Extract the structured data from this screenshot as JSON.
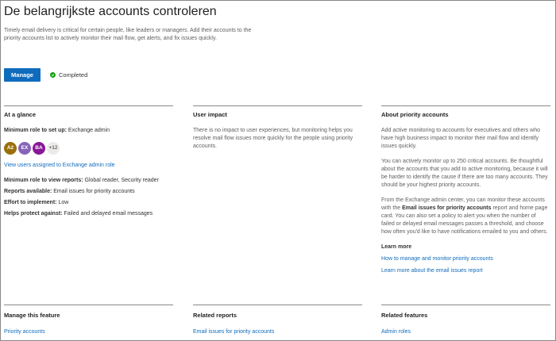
{
  "header": {
    "title": "De belangrijkste accounts controleren",
    "description": "Timely email delivery is critical for certain people, like leaders or managers. Add their accounts to the priority accounts list to actively monitor their mail flow, get alerts, and fix issues quickly.",
    "manage_label": "Manage",
    "status_label": "Completed",
    "status_color": "#13a10e",
    "accent_color": "#0f6cbd"
  },
  "glance": {
    "heading": "At a glance",
    "min_role_setup_label": "Minimum role to set up:",
    "min_role_setup_value": " Exchange admin",
    "avatars": [
      {
        "initials": "A2",
        "color": "#986f0b"
      },
      {
        "initials": "EX",
        "color": "#8764b8"
      },
      {
        "initials": "BA",
        "color": "#881798"
      }
    ],
    "avatars_more": "+12",
    "view_users_link": "View users assigned to Exchange admin role",
    "min_role_reports_label": "Minimum role to view reports:",
    "min_role_reports_value": " Global reader, Security reader",
    "reports_label": "Reports available:",
    "reports_value": " Email issues for priority accounts",
    "effort_label": "Effort to implement:",
    "effort_value": " Low",
    "protect_label": "Helps protect against:",
    "protect_value": " Failed and delayed email messages"
  },
  "impact": {
    "heading": "User impact",
    "text": "There is no impact to user experiences, but monitoring helps you resolve mail flow issues more quickly for the people using priority accounts."
  },
  "about": {
    "heading": "About priority accounts",
    "p1": "Add active monitoring to accounts for executives and others who have high business impact to monitor their mail flow and identify issues quickly.",
    "p2": "You can actively monitor up to 250 critical accounts. Be thoughtful about the accounts that you add to active monitoring, because it will be harder to identify the cause if there are too many accounts. They should be your highest priority accounts.",
    "p3_before": "From the Exchange admin center, you can monitor these accounts with the ",
    "p3_bold": "Email issues for priority accounts",
    "p3_after": " report and home page card. You can also set a policy to alert you when the number of failed or delayed email messages passes a threshold, and choose how often you'd like to have notifications emailed to you and others.",
    "learn_more": "Learn more",
    "link1": "How to manage and monitor priority accounts",
    "link2": "Learn more about the email issues report"
  },
  "footer": {
    "manage_heading": "Manage this feature",
    "manage_link": "Priority accounts",
    "reports_heading": "Related reports",
    "reports_link": "Email issues for priority accounts",
    "features_heading": "Related features",
    "features_link": "Admin roles"
  }
}
